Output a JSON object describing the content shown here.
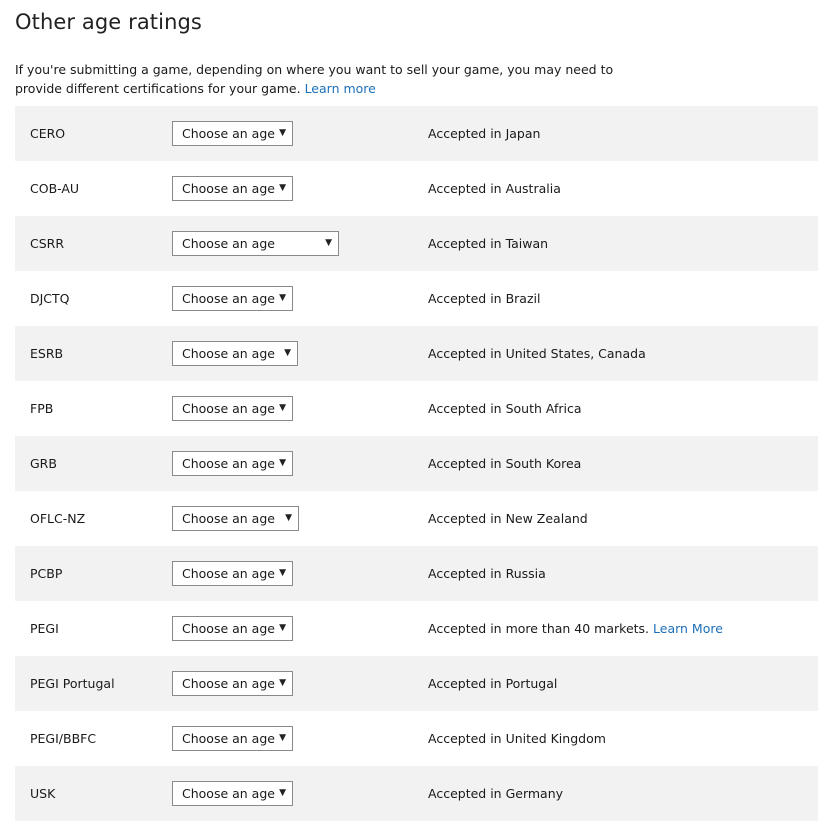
{
  "page": {
    "title": "Other age ratings",
    "intro_text": "If you're submitting a game, depending on where you want to sell your game, you may need to provide different certifications for your game.",
    "intro_link": "Learn more"
  },
  "ratings": [
    {
      "board": "CERO",
      "select_value": "Choose an age",
      "market": "Accepted in Japan"
    },
    {
      "board": "COB-AU",
      "select_value": "Choose an age",
      "market": "Accepted in Australia"
    },
    {
      "board": "CSRR",
      "select_value": "Choose an age",
      "market": "Accepted in Taiwan"
    },
    {
      "board": "DJCTQ",
      "select_value": "Choose an age",
      "market": "Accepted in Brazil"
    },
    {
      "board": "ESRB",
      "select_value": "Choose an age",
      "market": "Accepted in United States, Canada"
    },
    {
      "board": "FPB",
      "select_value": "Choose an age",
      "market": "Accepted in South Africa"
    },
    {
      "board": "GRB",
      "select_value": "Choose an age",
      "market": "Accepted in South Korea"
    },
    {
      "board": "OFLC-NZ",
      "select_value": "Choose an age",
      "market": "Accepted in New Zealand"
    },
    {
      "board": "PCBP",
      "select_value": "Choose an age",
      "market": "Accepted in Russia"
    },
    {
      "board": "PEGI",
      "select_value": "Choose an age",
      "market": "Accepted in more than 40 markets.",
      "market_link": "Learn More"
    },
    {
      "board": "PEGI Portugal",
      "select_value": "Choose an age",
      "market": "Accepted in Portugal"
    },
    {
      "board": "PEGI/BBFC",
      "select_value": "Choose an age",
      "market": "Accepted in United Kingdom"
    },
    {
      "board": "USK",
      "select_value": "Choose an age",
      "market": "Accepted in Germany"
    }
  ],
  "icons": {
    "dropdown_arrow": "▼"
  },
  "colors": {
    "link": "#1d6fb8",
    "row_shade": "#f2f2f2"
  }
}
